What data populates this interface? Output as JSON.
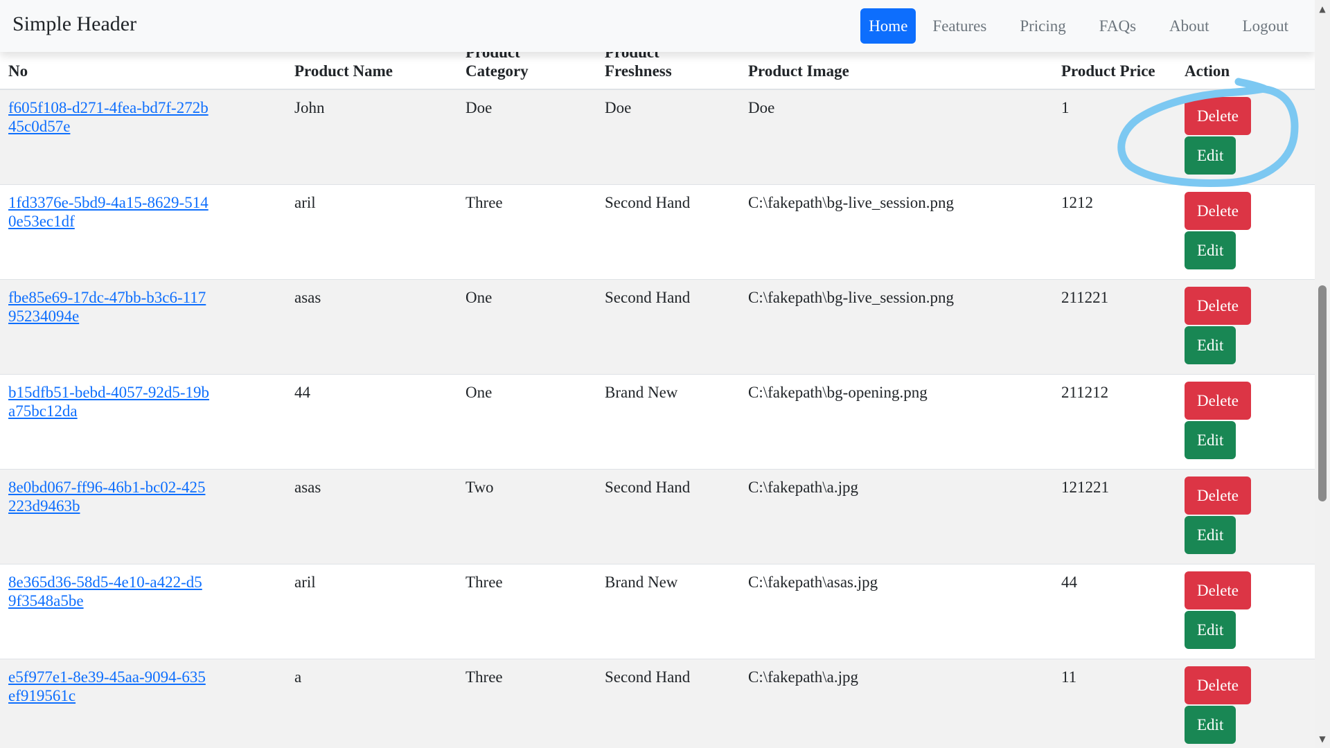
{
  "header": {
    "brand": "Simple Header",
    "nav": [
      "Home",
      "Features",
      "Pricing",
      "FAQs",
      "About",
      "Logout"
    ],
    "active_nav": "Home"
  },
  "table": {
    "columns": {
      "no": "No",
      "name": "Product Name",
      "category": "Product Category",
      "freshness": "Product Freshness",
      "image": "Product Image",
      "price": "Product Price",
      "action": "Action"
    },
    "rows": [
      {
        "id": "f605f108-d271-4fea-bd7f-272b45c0d57e",
        "name": "John",
        "category": "Doe",
        "freshness": "Doe",
        "image": "Doe",
        "price": "1"
      },
      {
        "id": "1fd3376e-5bd9-4a15-8629-5140e53ec1df",
        "name": "aril",
        "category": "Three",
        "freshness": "Second Hand",
        "image": "C:\\fakepath\\bg-live_session.png",
        "price": "1212"
      },
      {
        "id": "fbe85e69-17dc-47bb-b3c6-11795234094e",
        "name": "asas",
        "category": "One",
        "freshness": "Second Hand",
        "image": "C:\\fakepath\\bg-live_session.png",
        "price": "211221"
      },
      {
        "id": "b15dfb51-bebd-4057-92d5-19ba75bc12da",
        "name": "44",
        "category": "One",
        "freshness": "Brand New",
        "image": "C:\\fakepath\\bg-opening.png",
        "price": "211212"
      },
      {
        "id": "8e0bd067-ff96-46b1-bc02-425223d9463b",
        "name": "asas",
        "category": "Two",
        "freshness": "Second Hand",
        "image": "C:\\fakepath\\a.jpg",
        "price": "121221"
      },
      {
        "id": "8e365d36-58d5-4e10-a422-d59f3548a5be",
        "name": "aril",
        "category": "Three",
        "freshness": "Brand New",
        "image": "C:\\fakepath\\asas.jpg",
        "price": "44"
      },
      {
        "id": "e5f977e1-8e39-45aa-9094-635ef919561c",
        "name": "a",
        "category": "Three",
        "freshness": "Second Hand",
        "image": "C:\\fakepath\\a.jpg",
        "price": "11"
      }
    ],
    "delete_label": "Delete",
    "edit_label": "Edit"
  },
  "colors": {
    "primary": "#0d6efd",
    "danger": "#dc3545",
    "success": "#198754",
    "annotation": "#7cc8f2"
  }
}
